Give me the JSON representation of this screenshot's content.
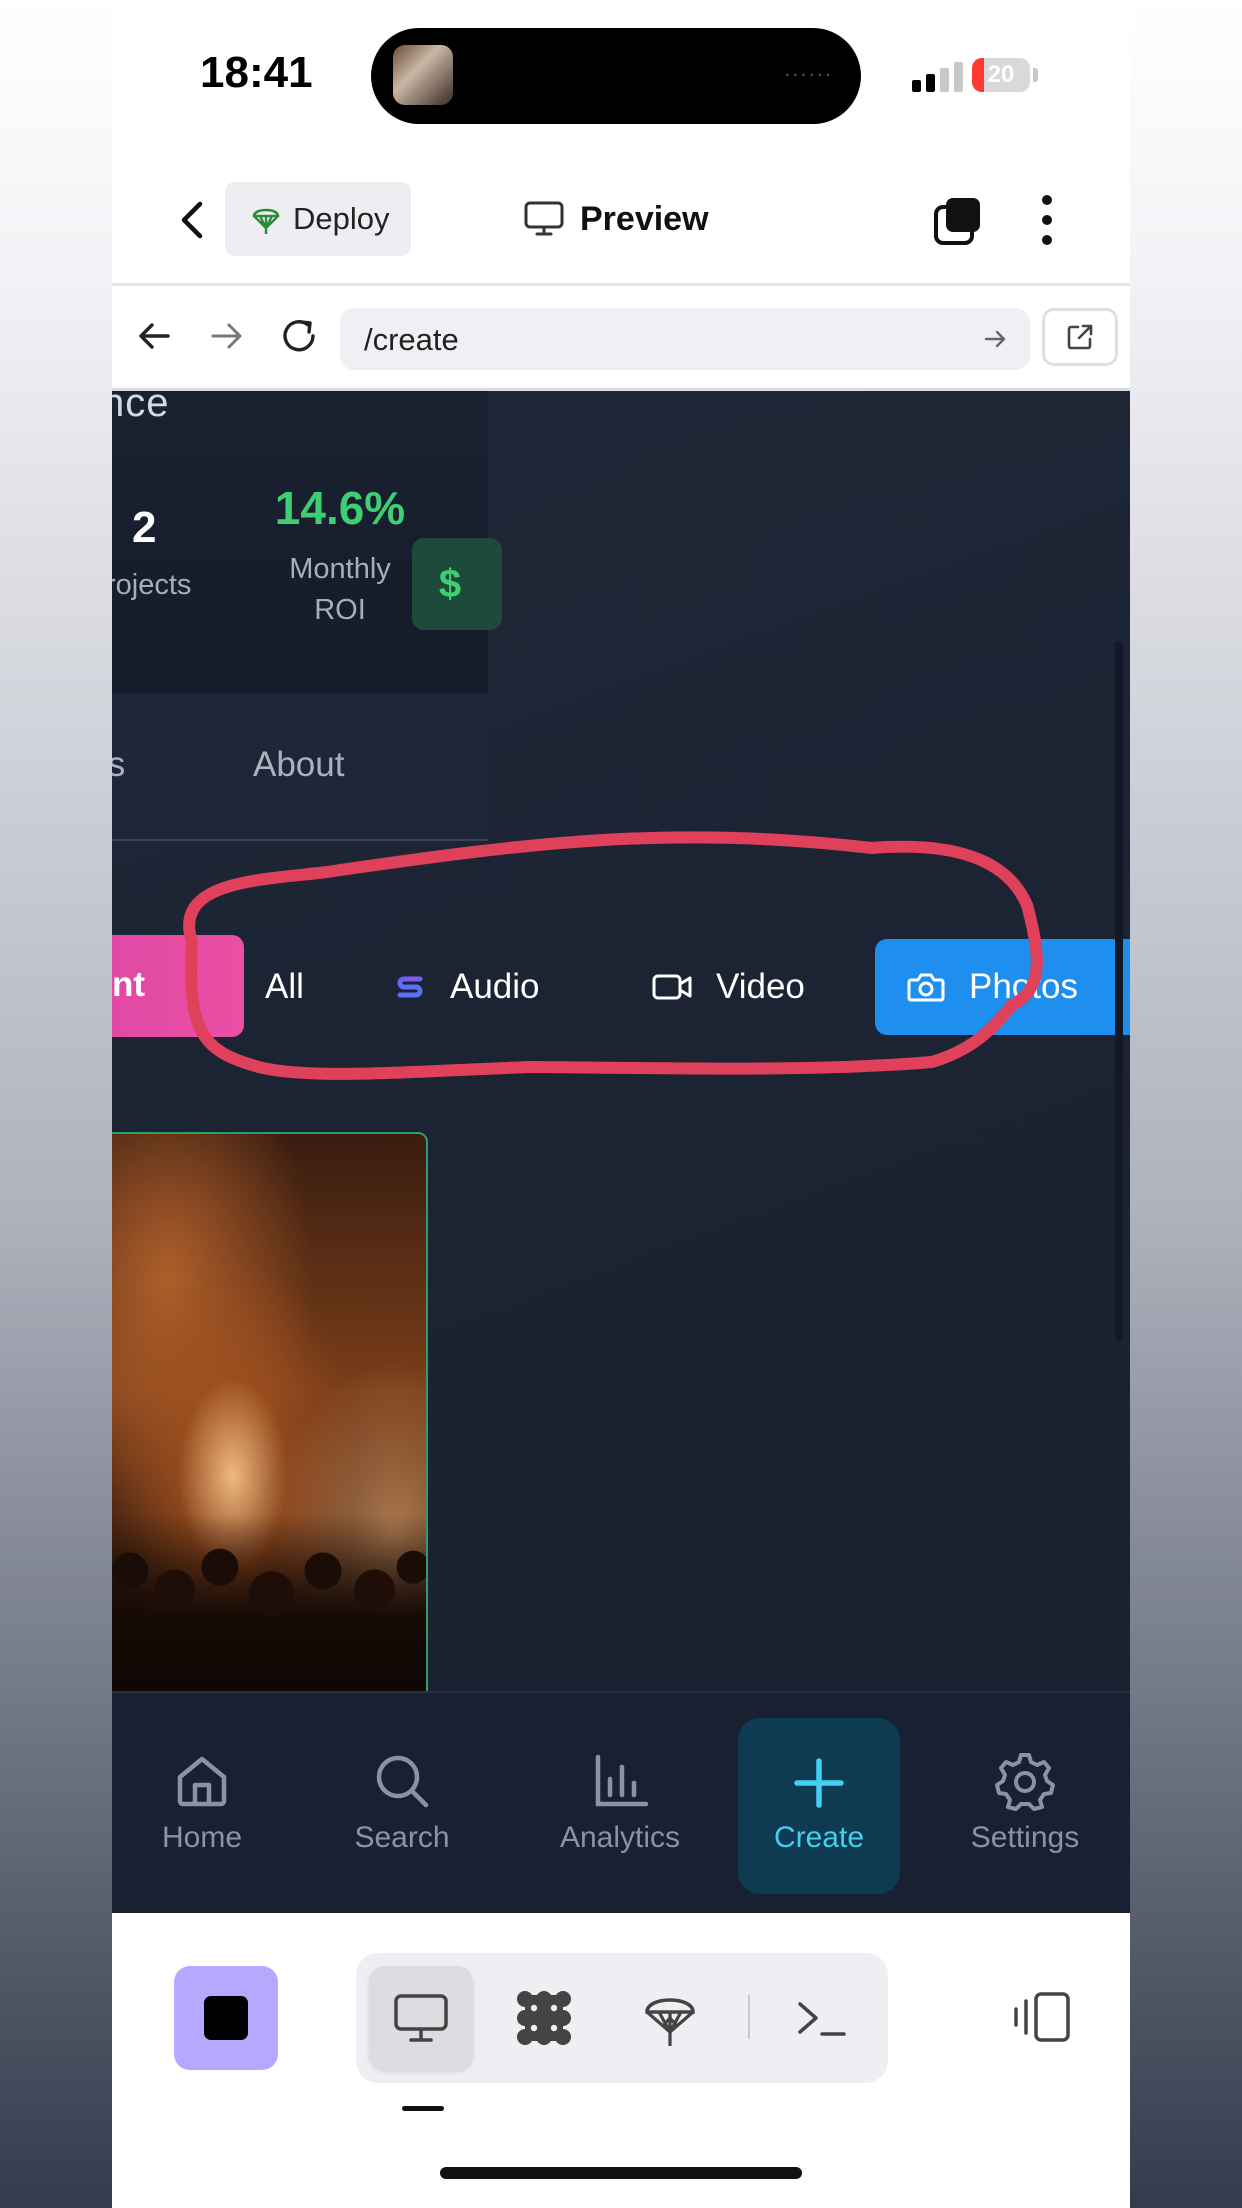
{
  "status_bar": {
    "time": "18:41",
    "battery_level": "20",
    "battery_fraction": 0.2,
    "signal_bars_active": 2,
    "signal_bars_total": 4,
    "island_dots": "......"
  },
  "toolbar": {
    "back_icon": "chevron-left-icon",
    "deploy_label": "Deploy",
    "deploy_icon": "parachute-icon",
    "preview_label": "Preview",
    "preview_icon": "monitor-icon",
    "tabs_icon": "stacked-squares-icon",
    "more_icon": "more-vertical-icon",
    "deploy_icon_color": "#2e8b3a"
  },
  "browser": {
    "url": "/create",
    "back_icon": "arrow-left-icon",
    "forward_icon": "arrow-right-icon",
    "reload_icon": "reload-icon",
    "go_icon": "arrow-right-icon",
    "open_external_icon": "external-link-icon"
  },
  "page": {
    "profile_heading": "nce",
    "projects_count": "2",
    "projects_label": "rojects",
    "roi_value": "14.6%",
    "roi_label": "Monthly ROI",
    "roi_color": "#3ecf72",
    "dollar_button": "$",
    "tabs": {
      "left_partial": "ts",
      "about": "About"
    },
    "pink_button": "nt",
    "filters": [
      {
        "label": "All",
        "icon": ""
      },
      {
        "label": "Audio",
        "icon": "audio-s-icon"
      },
      {
        "label": "Video",
        "icon": "video-camera-icon"
      },
      {
        "label": "Photos",
        "icon": "camera-icon",
        "active": true
      }
    ],
    "accent_blue": "#1f8fef",
    "photo_alt": "concert crowd photo"
  },
  "annotation": {
    "color": "#e0415a",
    "shape": "hand-drawn ellipse around filter buttons"
  },
  "app_nav": {
    "items": [
      {
        "label": "Home",
        "icon": "home-icon"
      },
      {
        "label": "Search",
        "icon": "search-icon"
      },
      {
        "label": "Analytics",
        "icon": "bar-chart-icon"
      },
      {
        "label": "Create",
        "icon": "plus-icon",
        "active": true
      },
      {
        "label": "Settings",
        "icon": "gear-icon"
      }
    ],
    "active_color": "#43d0ef"
  },
  "ide_bar": {
    "stop_icon": "stop-square-icon",
    "buttons": [
      {
        "icon": "monitor-icon",
        "active": true
      },
      {
        "icon": "grid-blob-icon"
      },
      {
        "icon": "parachute-icon"
      },
      {
        "icon": "terminal-icon"
      }
    ],
    "panel_icon": "panel-split-icon"
  }
}
